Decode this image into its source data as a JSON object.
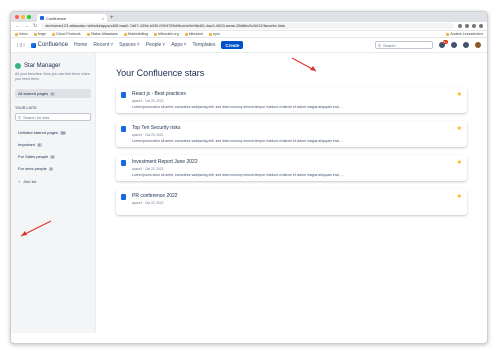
{
  "browser": {
    "tab_title": "Confluence",
    "new_tab": "+",
    "close": "×",
    "url": "devhome123.atlassian.net/wiki/apps/c80f-baa0-7a57-435e-b5f3-0994789d9bcb/e9e98c65-4ac0-4003-aeae-35d6bc5c5412/favorite-lists",
    "bookmarks": [
      "Inbox",
      "forge",
      "Cloud Products",
      "Status Atlassians",
      "Marketbilling",
      "bitbucket.org",
      "bitbucket",
      "npm"
    ],
    "bookmarks_right": "Andere Lesezeichen",
    "traffic_colors": [
      "#ff5f57",
      "#febc2e",
      "#28c840"
    ]
  },
  "header": {
    "logo": "Confluence",
    "nav": [
      {
        "label": "Home",
        "chevron": false
      },
      {
        "label": "Recent",
        "chevron": true
      },
      {
        "label": "Spaces",
        "chevron": true
      },
      {
        "label": "People",
        "chevron": true
      },
      {
        "label": "Apps",
        "chevron": true
      },
      {
        "label": "Templates",
        "chevron": false
      }
    ],
    "create": "Create",
    "search_placeholder": "Search",
    "notification_count": "9+",
    "accent": "#0052cc"
  },
  "sidebar": {
    "title": "Star Manager",
    "description": "All your favorites. Now you can find them when you need them.",
    "all_starred": {
      "label": "All starred pages",
      "count": "4"
    },
    "lists_heading": "YOUR LISTS",
    "search_placeholder": "Search for lists",
    "lists": [
      {
        "label": "Unlisted starred pages",
        "count": "46"
      },
      {
        "label": "Important",
        "count": "3"
      },
      {
        "label": "For Sales people",
        "count": "1"
      },
      {
        "label": "For devs people",
        "count": "2"
      }
    ],
    "add_list": "Add list"
  },
  "main": {
    "title": "Your Confluence stars",
    "cards": [
      {
        "title": "React js - Best practices",
        "meta": "space1 · Oct 23, 2022",
        "excerpt": "Lorem ipsum dolor sit amet, consetetur sadipscing elitr, sed diam nonumy eirmod tempor invidunt ut labore et dolore magna aliquyam erat, ..."
      },
      {
        "title": "Top Ten Security risks",
        "meta": "space1 · Oct 23, 2022",
        "excerpt": "Lorem ipsum dolor sit amet, consetetur sadipscing elitr, sed diam nonumy eirmod tempor invidunt ut labore et dolore magna aliquyam erat, ..."
      },
      {
        "title": "Investment Report June 2022",
        "meta": "space1 · Oct 22, 2022",
        "excerpt": "Lorem ipsum dolor sit amet, consetetur sadipscing elitr, sed diam nonumy eirmod tempor invidunt ut labore et dolore magna aliquyam erat, ..."
      },
      {
        "title": "PR conference 2022",
        "meta": "space1 · Oct 22, 2022",
        "excerpt": ""
      }
    ],
    "star_color": "#ffab00"
  }
}
